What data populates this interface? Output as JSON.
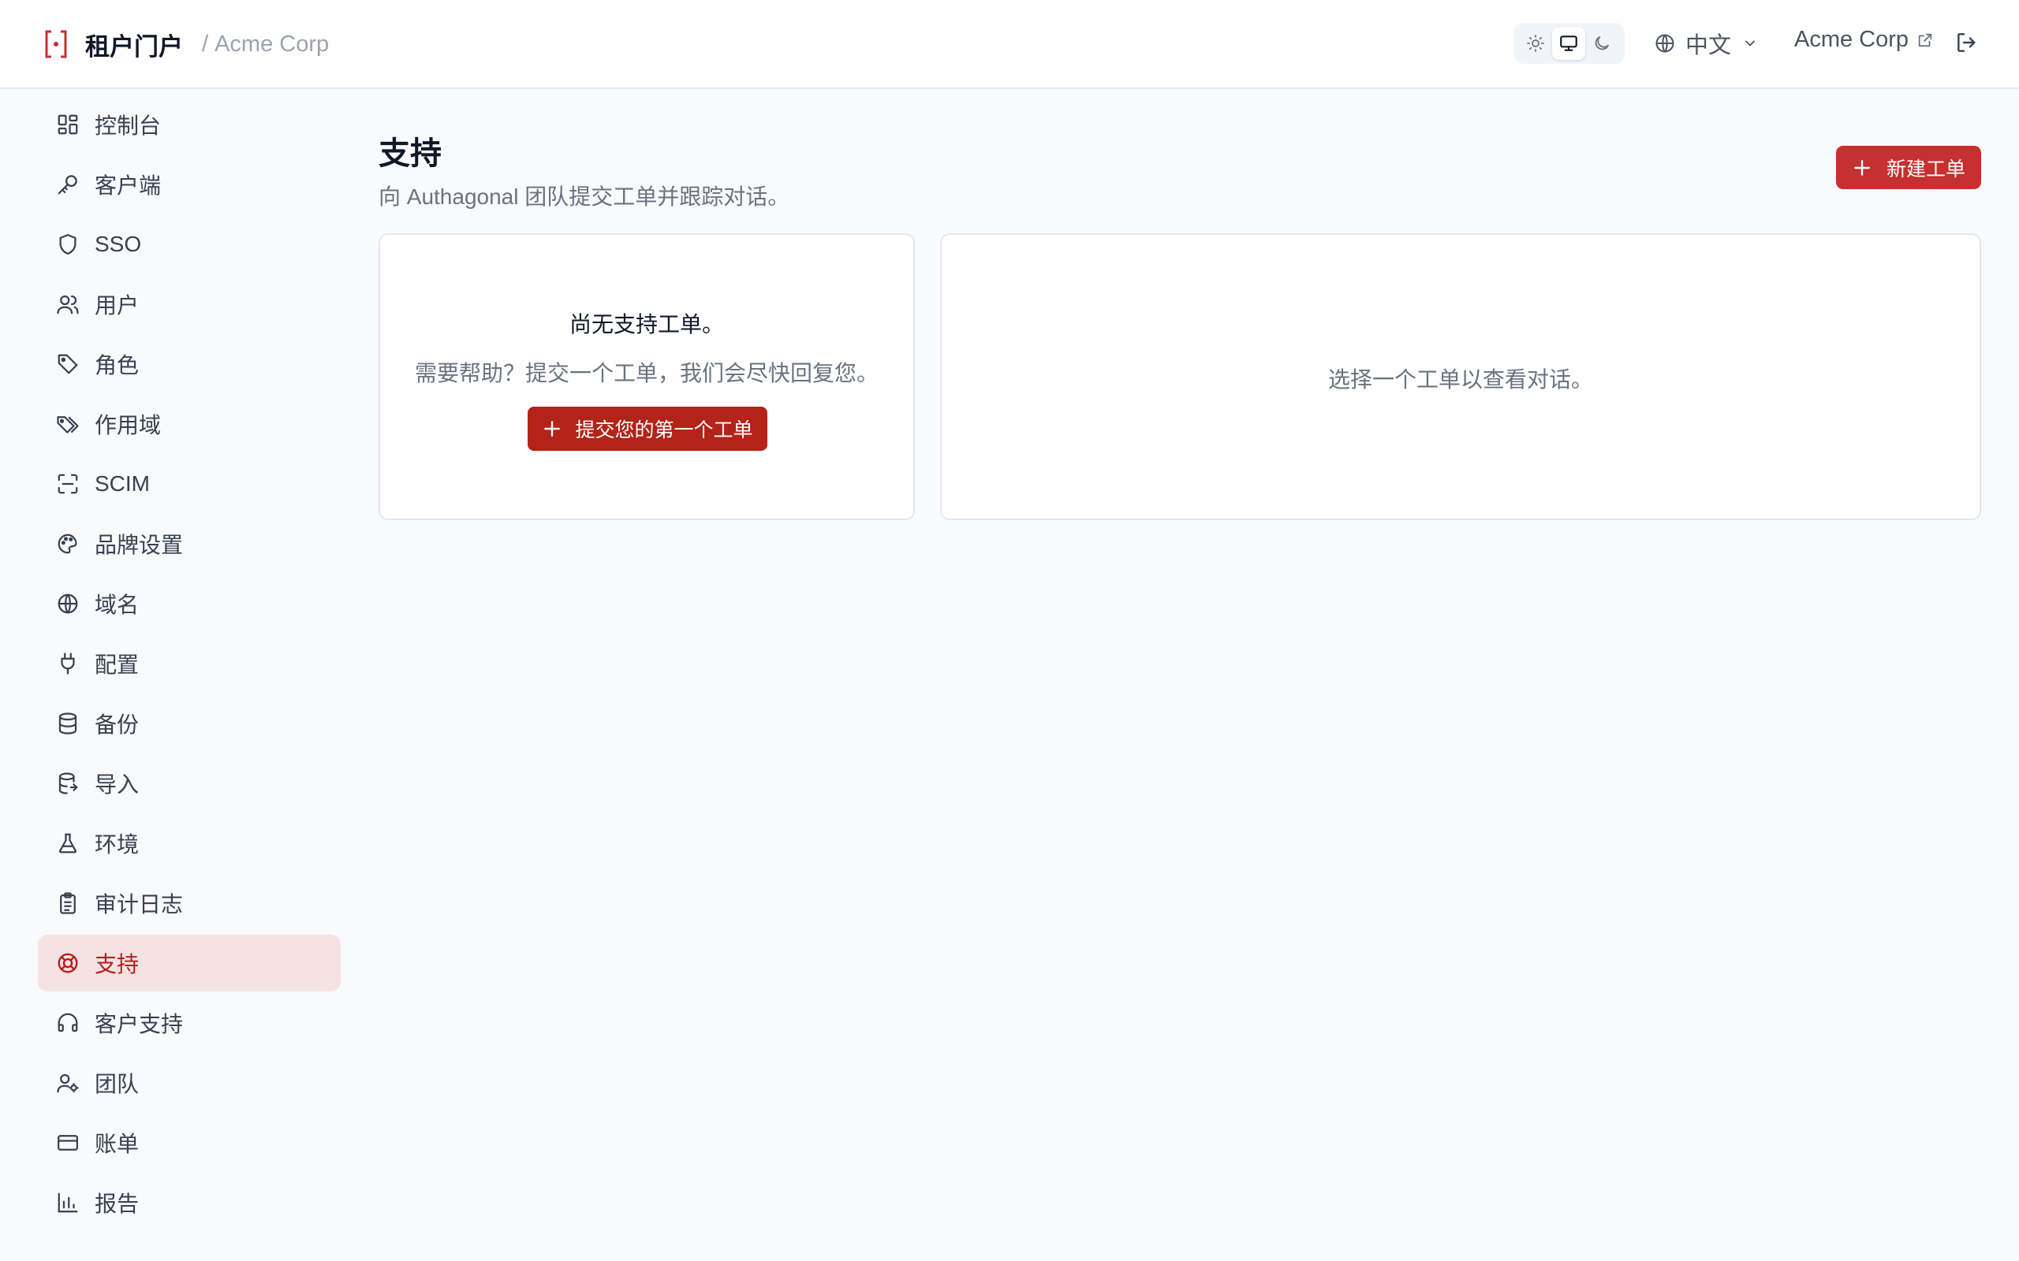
{
  "header": {
    "title": "租户门户",
    "separator": "/",
    "tenant": "Acme Corp",
    "language": "中文",
    "tenant_link": "Acme Corp"
  },
  "sidebar": {
    "items": [
      {
        "label": "控制台",
        "icon": "dashboard-icon"
      },
      {
        "label": "客户端",
        "icon": "key-icon"
      },
      {
        "label": "SSO",
        "icon": "shield-icon"
      },
      {
        "label": "用户",
        "icon": "users-icon"
      },
      {
        "label": "角色",
        "icon": "tag-icon"
      },
      {
        "label": "作用域",
        "icon": "tags-icon"
      },
      {
        "label": "SCIM",
        "icon": "scan-icon"
      },
      {
        "label": "品牌设置",
        "icon": "palette-icon"
      },
      {
        "label": "域名",
        "icon": "globe-icon"
      },
      {
        "label": "配置",
        "icon": "plug-icon"
      },
      {
        "label": "备份",
        "icon": "database-icon"
      },
      {
        "label": "导入",
        "icon": "database-import-icon"
      },
      {
        "label": "环境",
        "icon": "flask-icon"
      },
      {
        "label": "审计日志",
        "icon": "clipboard-icon"
      },
      {
        "label": "支持",
        "icon": "life-buoy-icon",
        "active": true
      },
      {
        "label": "客户支持",
        "icon": "headset-icon"
      },
      {
        "label": "团队",
        "icon": "user-cog-icon"
      },
      {
        "label": "账单",
        "icon": "credit-card-icon"
      },
      {
        "label": "报告",
        "icon": "bar-chart-icon"
      }
    ]
  },
  "main": {
    "title": "支持",
    "subtitle": "向 Authagonal 团队提交工单并跟踪对话。",
    "new_ticket_label": "新建工单",
    "empty_title": "尚无支持工单。",
    "empty_desc": "需要帮助？提交一个工单，我们会尽快回复您。",
    "first_ticket_label": "提交您的第一个工单",
    "select_hint": "选择一个工单以查看对话。"
  },
  "colors": {
    "accent": "#c53030",
    "active_bg": "#f5e3e4",
    "active_text": "#b91c1c"
  }
}
